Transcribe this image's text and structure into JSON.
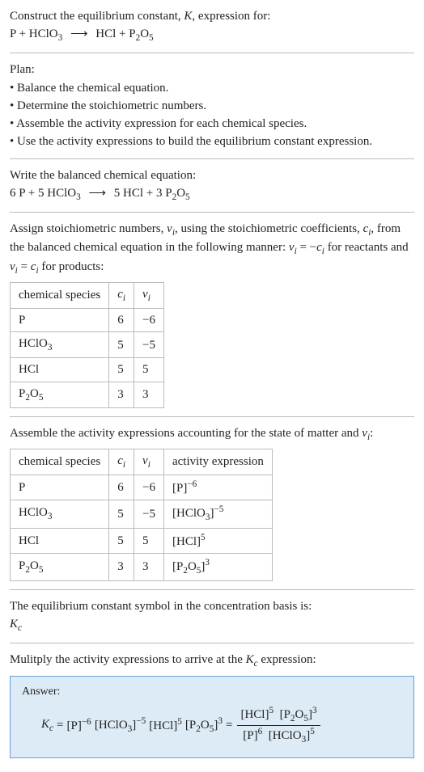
{
  "header": {
    "line1_a": "Construct the equilibrium constant, ",
    "line1_b": ", expression for:",
    "K": "K",
    "reaction_lhs1": "P",
    "plus": " + ",
    "reaction_lhs2": "HClO",
    "sub3": "3",
    "arrow": "⟶",
    "rhs1": "HCl",
    "rhs2": "P",
    "sub2": "2",
    "O": "O",
    "sub5": "5"
  },
  "plan": {
    "title": "Plan:",
    "b1": "• Balance the chemical equation.",
    "b2": "• Determine the stoichiometric numbers.",
    "b3": "• Assemble the activity expression for each chemical species.",
    "b4": "• Use the activity expressions to build the equilibrium constant expression."
  },
  "balanced": {
    "intro": "Write the balanced chemical equation:",
    "c_P": "6",
    "P": " P",
    "c_HClO3": "5",
    "HClO3": " HClO",
    "sub3": "3",
    "arrow": "⟶",
    "c_HCl": "5",
    "HCl": " HCl",
    "c_P2O5": "3",
    "P2": " P",
    "sub2": "2",
    "O": "O",
    "sub5": "5",
    "plus": " + "
  },
  "stoich": {
    "intro1": "Assign stoichiometric numbers, ",
    "nu_i": "ν",
    "sub_i": "i",
    "intro2": ", using the stoichiometric coefficients, ",
    "c_i": "c",
    "intro3": ", from the balanced chemical equation in the following manner: ",
    "eq1a": " = −",
    "intro4": " for reactants and ",
    "eq2a": " = ",
    "intro5": " for products:"
  },
  "table1": {
    "h1": "chemical species",
    "h2_c": "c",
    "h2_i": "i",
    "h3_n": "ν",
    "h3_i": "i",
    "rows": [
      {
        "sp_a": "P",
        "sp_b": "",
        "sp_c": "",
        "c": "6",
        "n": "−6"
      },
      {
        "sp_a": "HClO",
        "sp_b": "3",
        "sp_c": "",
        "c": "5",
        "n": "−5"
      },
      {
        "sp_a": "HCl",
        "sp_b": "",
        "sp_c": "",
        "c": "5",
        "n": "5"
      },
      {
        "sp_a": "P",
        "sp_b": "2",
        "sp_c": "O",
        "sp_d": "5",
        "c": "3",
        "n": "3"
      }
    ]
  },
  "activity_intro": {
    "t1": "Assemble the activity expressions accounting for the state of matter and ",
    "nu": "ν",
    "i": "i",
    "t2": ":"
  },
  "table2": {
    "h1": "chemical species",
    "h2_c": "c",
    "h2_i": "i",
    "h3_n": "ν",
    "h3_i": "i",
    "h4": "activity expression",
    "rows": [
      {
        "sp": "P",
        "c": "6",
        "n": "−6",
        "br_l": "[",
        "ex": "P",
        "br_r": "]",
        "pow": "−6"
      },
      {
        "sp": "HClO",
        "sp_sub": "3",
        "c": "5",
        "n": "−5",
        "br_l": "[",
        "ex": "HClO",
        "ex_sub": "3",
        "br_r": "]",
        "pow": "−5"
      },
      {
        "sp": "HCl",
        "c": "5",
        "n": "5",
        "br_l": "[",
        "ex": "HCl",
        "br_r": "]",
        "pow": "5"
      },
      {
        "sp": "P",
        "sp_sub": "2",
        "sp_c": "O",
        "sp_d": "5",
        "c": "3",
        "n": "3",
        "br_l": "[",
        "ex": "P",
        "ex_sub": "2",
        "ex_c": "O",
        "ex_d": "5",
        "br_r": "]",
        "pow": "3"
      }
    ]
  },
  "kc_symbol": {
    "t1": "The equilibrium constant symbol in the concentration basis is:",
    "K": "K",
    "c": "c"
  },
  "multiply": {
    "t1": "Mulitply the activity expressions to arrive at the ",
    "K": "K",
    "c": "c",
    "t2": " expression:"
  },
  "answer": {
    "label": "Answer:",
    "K": "K",
    "c": "c",
    "eq": " = ",
    "lb": "[",
    "rb": "]",
    "P": "P",
    "pow_n6": "−6",
    "HClO": "HClO",
    "s3": "3",
    "pow_n5": "−5",
    "HCl": "HCl",
    "pow5": "5",
    "P2": "P",
    "s2": "2",
    "O": "O",
    "s5": "5",
    "pow3": "3",
    "eq2": " = ",
    "pow6": "6"
  }
}
